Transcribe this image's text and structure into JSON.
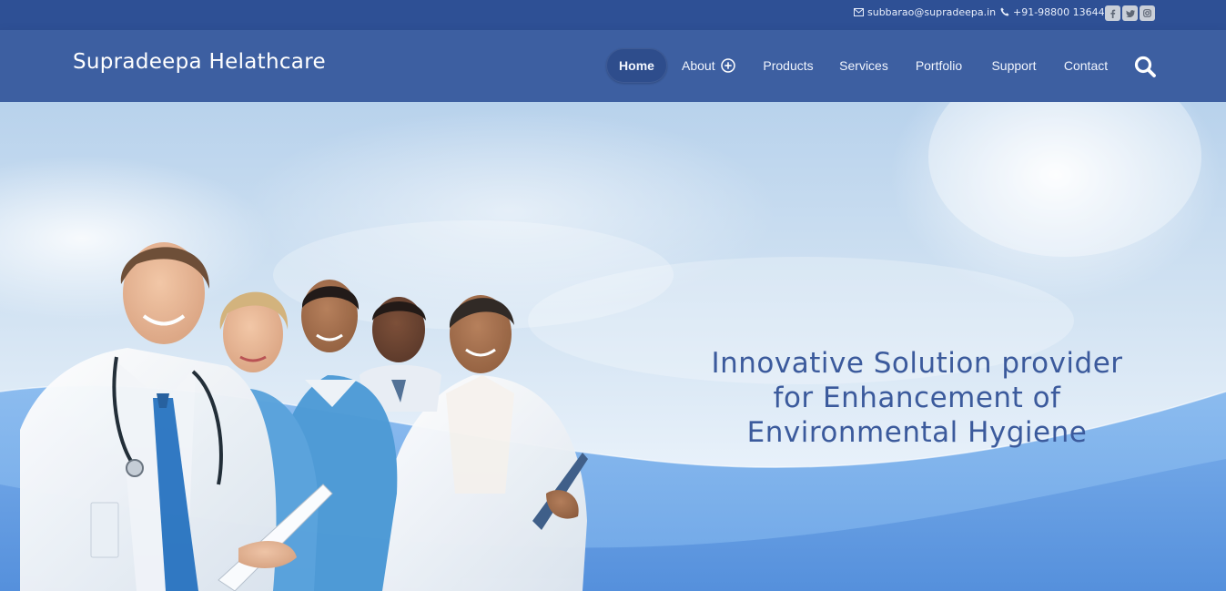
{
  "topbar": {
    "email": "subbarao@supradeepa.in",
    "phone": "+91-98800 13644",
    "social": [
      {
        "name": "facebook-icon",
        "glyph": "f"
      },
      {
        "name": "twitter-icon",
        "glyph": "t"
      },
      {
        "name": "instagram-icon",
        "glyph": "◎"
      }
    ]
  },
  "header": {
    "brand": "Supradeepa Helathcare",
    "nav": [
      {
        "label": "Home",
        "active": true
      },
      {
        "label": "About",
        "has_submenu": true
      },
      {
        "label": "Products"
      },
      {
        "label": "Services"
      },
      {
        "label": "Portfolio"
      },
      {
        "label": "Support"
      },
      {
        "label": "Contact"
      }
    ],
    "search_icon": "search-icon"
  },
  "hero": {
    "headline_lines": [
      "Innovative Solution provider",
      "for Enhancement of",
      "Environmental Hygiene"
    ],
    "image_description_icon": "doctors-group-photo"
  },
  "colors": {
    "topbar_bg": "#2e5095",
    "header_bg": "#3d5fa1",
    "nav_active_bg": "#2e4d8c",
    "headline": "#3b5a9c",
    "wave_light": "#7aaee8",
    "wave_dark": "#5a93df"
  }
}
